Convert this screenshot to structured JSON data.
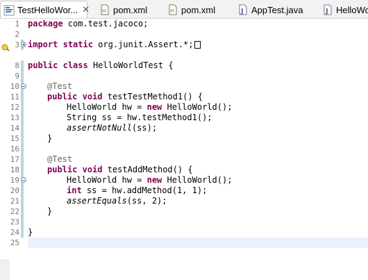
{
  "tabs": [
    {
      "label": "TestHelloWor...",
      "icon": "java-class-icon",
      "close": "✕",
      "active": true
    },
    {
      "label": "pom.xml",
      "icon": "xml-file-icon",
      "active": false
    },
    {
      "label": "pom.xml",
      "icon": "xml-file-icon",
      "active": false
    },
    {
      "label": "AppTest.java",
      "icon": "java-file-icon",
      "active": false
    },
    {
      "label": "HelloWo",
      "icon": "java-file-icon",
      "active": false
    }
  ],
  "editor": {
    "line_numbers": [
      "1",
      "2",
      "3",
      "7",
      "8",
      "9",
      "10",
      "11",
      "12",
      "13",
      "14",
      "15",
      "16",
      "17",
      "18",
      "19",
      "20",
      "21",
      "22",
      "23",
      "24",
      "25"
    ],
    "current_line": "25",
    "folded_line": "3",
    "warning_line": "3",
    "colors": {
      "keyword": "#7f0055",
      "annotation": "#646464",
      "change_bar": "#b6d7de",
      "current_line": "#e8f2fe"
    },
    "lines": {
      "l1": {
        "kw": "package",
        "rest": " com.test.jacoco;"
      },
      "l3": {
        "kw1": "import",
        "kw2": "static",
        "rest": " org.junit.Assert.*;"
      },
      "l8": {
        "kw1": "public",
        "kw2": "class",
        "rest": " HelloWorldTest {"
      },
      "l10": {
        "ann": "@Test"
      },
      "l11": {
        "kw1": "public",
        "kw2": "void",
        "rest": " testTestMethod1() {"
      },
      "l12": {
        "a": "HelloWorld hw = ",
        "kw": "new",
        "b": " HelloWorld();"
      },
      "l13": {
        "text": "String ss = hw.testMethod1();"
      },
      "l14": {
        "it": "assertNotNull",
        "rest": "(ss);"
      },
      "l15": {
        "text": "}"
      },
      "l17": {
        "ann": "@Test"
      },
      "l18": {
        "kw1": "public",
        "kw2": "void",
        "rest": " testAddMethod() {"
      },
      "l19": {
        "a": "HelloWorld hw = ",
        "kw": "new",
        "b": " HelloWorld();"
      },
      "l20": {
        "kw": "int",
        "rest": " ss = hw.addMethod(1, 1);"
      },
      "l21": {
        "it": "assertEquals",
        "rest": "(ss, 2);"
      },
      "l22": {
        "text": "}"
      },
      "l24": {
        "text": "}"
      }
    }
  }
}
